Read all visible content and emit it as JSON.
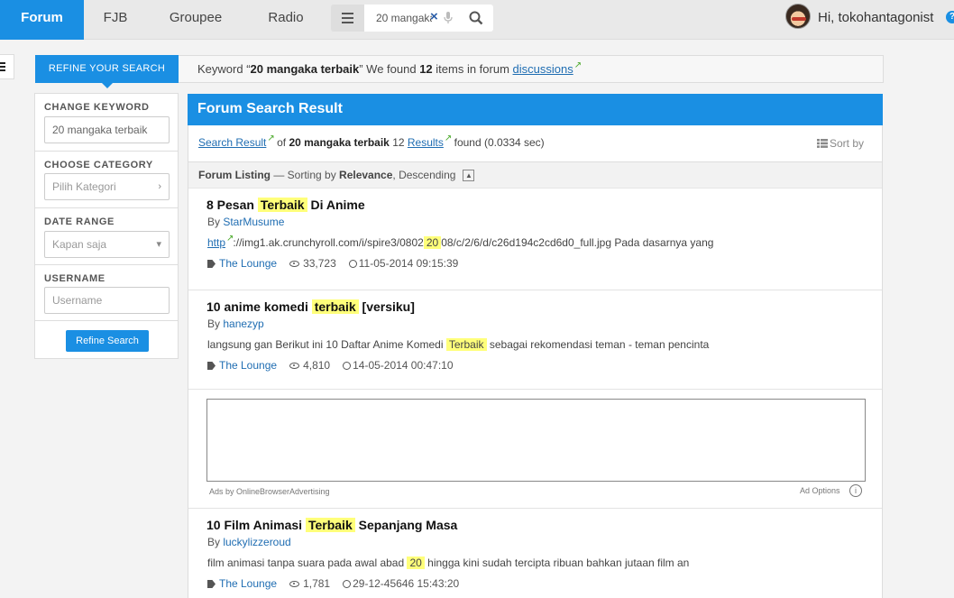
{
  "nav": {
    "tabs": [
      "Forum",
      "FJB",
      "Groupee",
      "Radio"
    ],
    "search_value": "20 mangaka",
    "greeting": "Hi, tokohantagonist",
    "help": "?"
  },
  "refine": {
    "title": "REFINE YOUR SEARCH",
    "keyword_prefix": "Keyword “",
    "keyword": "20 mangaka terbaik",
    "keyword_mid": "” We found ",
    "count": "12",
    "keyword_suffix": " items in forum ",
    "forum_link": "discussions"
  },
  "filters": {
    "change_keyword": {
      "label": "CHANGE KEYWORD",
      "value": "20 mangaka terbaik"
    },
    "category": {
      "label": "CHOOSE CATEGORY",
      "placeholder": "Pilih Kategori"
    },
    "date_range": {
      "label": "DATE RANGE",
      "placeholder": "Kapan saja"
    },
    "username": {
      "label": "USERNAME",
      "placeholder": "Username"
    },
    "button": "Refine Search"
  },
  "results": {
    "title": "Forum Search Result",
    "summary": {
      "search_result_link": "Search Result",
      "of": " of ",
      "keyword": "20 mangaka terbaik",
      "count": " 12 ",
      "results_link": "Results",
      "found": " found (0.0334 sec)"
    },
    "sort_by": "Sort by",
    "listing": {
      "label": "Forum Listing",
      "sep": " — Sorting by ",
      "sort": "Relevance",
      "order": ", Descending"
    },
    "items": [
      {
        "title_pre": "8 Pesan ",
        "title_hl": "Terbaik",
        "title_post": " Di Anime",
        "by": "By ",
        "author": "StarMusume",
        "snippet_link": "http",
        "snippet_pre": "://img1.ak.crunchyroll.com/i/spire3/0802",
        "snippet_hl": "20",
        "snippet_post": "08/c/2/6/d/c26d194c2cd6d0_full.jpg Pada dasarnya yang",
        "forum": "The Lounge",
        "views": "33,723",
        "date": "11-05-2014 09:15:39"
      },
      {
        "title_pre": "10 anime komedi ",
        "title_hl": "terbaik",
        "title_post": " [versiku]",
        "by": "By ",
        "author": "hanezyp",
        "snippet_pre": "langsung gan Berikut ini 10 Daftar Anime Komedi ",
        "snippet_hl": "Terbaik",
        "snippet_post": " sebagai rekomendasi teman - teman pencinta",
        "forum": "The Lounge",
        "views": "4,810",
        "date": "14-05-2014 00:47:10"
      },
      {
        "title_pre": "10 Film Animasi ",
        "title_hl": "Terbaik",
        "title_post": " Sepanjang Masa",
        "by": "By ",
        "author": "luckylizzeroud",
        "snippet_pre": "film animasi tanpa suara pada awal abad ",
        "snippet_hl": "20",
        "snippet_post": " hingga kini sudah tercipta ribuan bahkan jutaan film an",
        "forum": "The Lounge",
        "views": "1,781",
        "date": "29-12-45646 15:43:20"
      }
    ],
    "ad": {
      "by": "Ads by OnlineBrowserAdvertising",
      "options": "Ad Options",
      "info": "i"
    }
  },
  "colors": {
    "accent": "#1a8fe3",
    "highlight": "#ffff7a",
    "link": "#1f6db2"
  }
}
